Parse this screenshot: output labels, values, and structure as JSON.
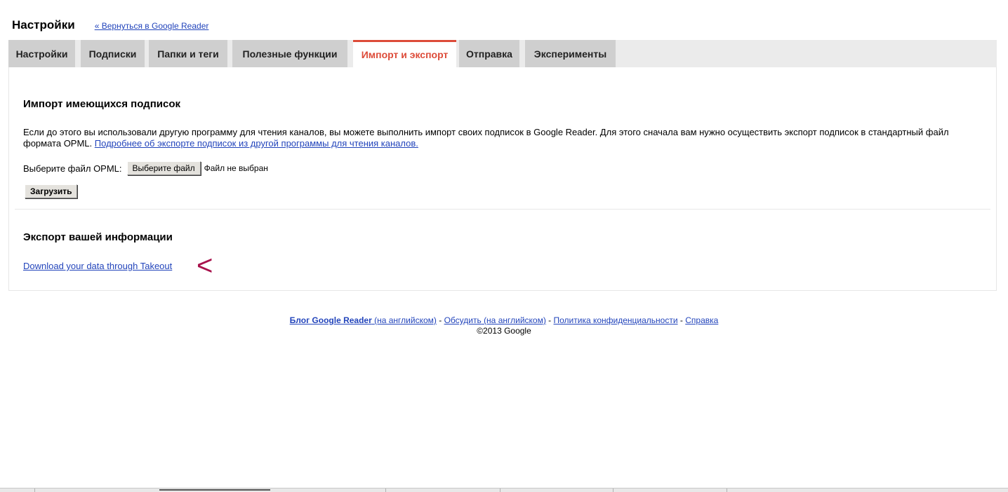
{
  "header": {
    "title": "Настройки",
    "back_link": "« Вернуться в Google Reader"
  },
  "tabs": [
    {
      "label": "Настройки",
      "active": false
    },
    {
      "label": "Подписки",
      "active": false
    },
    {
      "label": "Папки и теги",
      "active": false
    },
    {
      "label": "Полезные функции",
      "active": false
    },
    {
      "label": "Импорт и экспорт",
      "active": true
    },
    {
      "label": "Отправка",
      "active": false
    },
    {
      "label": "Эксперименты",
      "active": false
    }
  ],
  "import": {
    "title": "Импорт имеющихся подписок",
    "description": "Если до этого вы использовали другую программу для чтения каналов, вы можете выполнить импорт своих подписок в Google Reader. Для этого сначала вам нужно осуществить экспорт подписок в стандартный файл формата OPML.",
    "more_link": "Подробнее об экспорте подписок из другой программы для чтения каналов.",
    "file_label": "Выберите файл OPML:",
    "choose_button": "Выберите файл",
    "no_file": "Файл не выбран",
    "upload_button": "Загрузить"
  },
  "export": {
    "title": "Экспорт вашей информации",
    "takeout_link": "Download your data through Takeout",
    "annotation_mark": "<"
  },
  "footer": {
    "blog_strong": "Блог Google Reader",
    "blog_lang": "(на английском)",
    "sep": "-",
    "discuss": "Обсудить",
    "discuss_lang": "(на английском)",
    "privacy": "Политика конфиденциальности",
    "help": "Справка",
    "copyright": "©2013 Google"
  },
  "colors": {
    "active_tab": "#dd4b39",
    "link": "#2244bb",
    "annotation": "#a8124c"
  }
}
